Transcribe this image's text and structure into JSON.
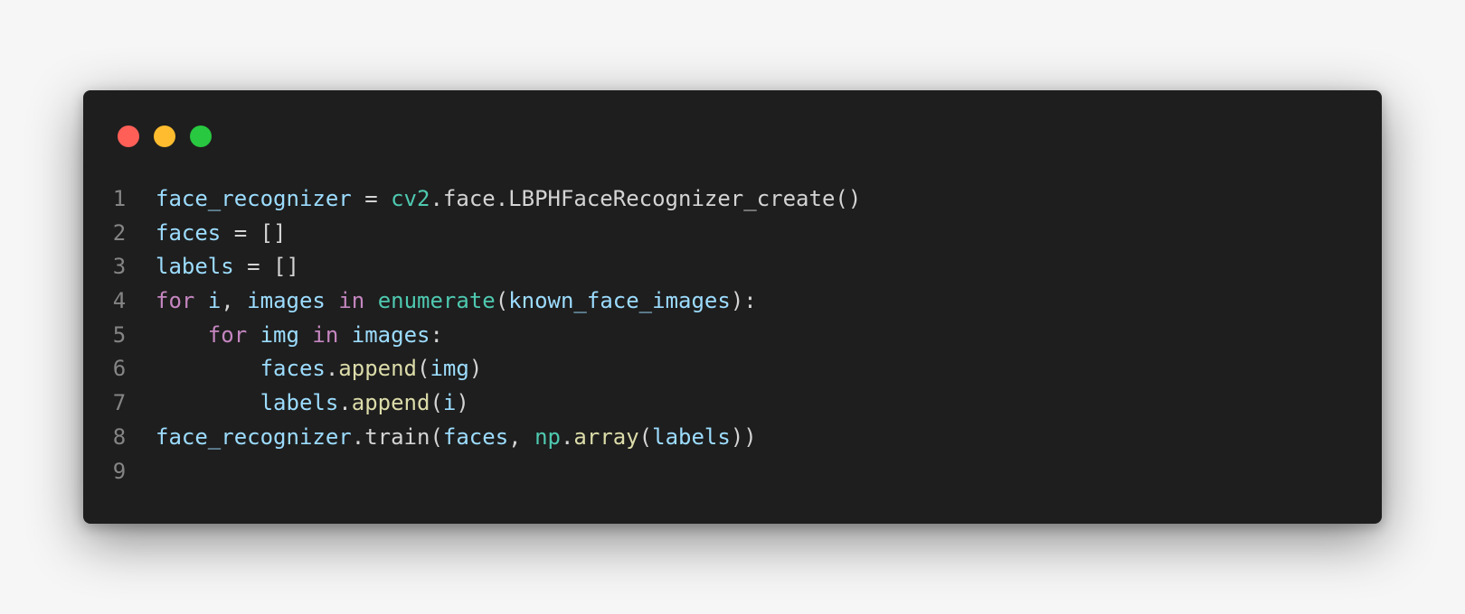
{
  "window": {
    "controls": [
      {
        "name": "close",
        "color": "#ff5f57"
      },
      {
        "name": "minimize",
        "color": "#febc2e"
      },
      {
        "name": "zoom",
        "color": "#28c840"
      }
    ]
  },
  "colors": {
    "background": "#1e1e1e",
    "variable": "#9cdcfe",
    "keyword": "#c586c0",
    "module": "#4ec9b0",
    "function": "#dcdcaa",
    "plain": "#d4d4d4",
    "line_number": "#858585"
  },
  "code": {
    "lines": [
      {
        "number": "1",
        "indent": "",
        "tokens": [
          {
            "text": "face_recognizer",
            "type": "variable"
          },
          {
            "text": " = ",
            "type": "plain"
          },
          {
            "text": "cv2",
            "type": "module"
          },
          {
            "text": ".face.LBPHFaceRecognizer_create()",
            "type": "plain"
          }
        ]
      },
      {
        "number": "2",
        "indent": "",
        "tokens": [
          {
            "text": "faces",
            "type": "variable"
          },
          {
            "text": " = []",
            "type": "plain"
          }
        ]
      },
      {
        "number": "3",
        "indent": "",
        "tokens": [
          {
            "text": "labels",
            "type": "variable"
          },
          {
            "text": " = []",
            "type": "plain"
          }
        ]
      },
      {
        "number": "4",
        "indent": "",
        "tokens": [
          {
            "text": "for",
            "type": "keyword"
          },
          {
            "text": " ",
            "type": "plain"
          },
          {
            "text": "i",
            "type": "variable"
          },
          {
            "text": ", ",
            "type": "plain"
          },
          {
            "text": "images",
            "type": "variable"
          },
          {
            "text": " ",
            "type": "plain"
          },
          {
            "text": "in",
            "type": "keyword"
          },
          {
            "text": " ",
            "type": "plain"
          },
          {
            "text": "enumerate",
            "type": "module"
          },
          {
            "text": "(",
            "type": "plain"
          },
          {
            "text": "known_face_images",
            "type": "variable"
          },
          {
            "text": "):",
            "type": "plain"
          }
        ]
      },
      {
        "number": "5",
        "indent": "    ",
        "tokens": [
          {
            "text": "for",
            "type": "keyword"
          },
          {
            "text": " ",
            "type": "plain"
          },
          {
            "text": "img",
            "type": "variable"
          },
          {
            "text": " ",
            "type": "plain"
          },
          {
            "text": "in",
            "type": "keyword"
          },
          {
            "text": " ",
            "type": "plain"
          },
          {
            "text": "images",
            "type": "variable"
          },
          {
            "text": ":",
            "type": "plain"
          }
        ]
      },
      {
        "number": "6",
        "indent": "        ",
        "tokens": [
          {
            "text": "faces",
            "type": "variable"
          },
          {
            "text": ".",
            "type": "plain"
          },
          {
            "text": "append",
            "type": "function"
          },
          {
            "text": "(",
            "type": "plain"
          },
          {
            "text": "img",
            "type": "variable"
          },
          {
            "text": ")",
            "type": "plain"
          }
        ]
      },
      {
        "number": "7",
        "indent": "        ",
        "tokens": [
          {
            "text": "labels",
            "type": "variable"
          },
          {
            "text": ".",
            "type": "plain"
          },
          {
            "text": "append",
            "type": "function"
          },
          {
            "text": "(",
            "type": "plain"
          },
          {
            "text": "i",
            "type": "variable"
          },
          {
            "text": ")",
            "type": "plain"
          }
        ]
      },
      {
        "number": "8",
        "indent": "",
        "tokens": [
          {
            "text": "face_recognizer",
            "type": "variable"
          },
          {
            "text": ".train(",
            "type": "plain"
          },
          {
            "text": "faces",
            "type": "variable"
          },
          {
            "text": ", ",
            "type": "plain"
          },
          {
            "text": "np",
            "type": "module"
          },
          {
            "text": ".",
            "type": "plain"
          },
          {
            "text": "array",
            "type": "function"
          },
          {
            "text": "(",
            "type": "plain"
          },
          {
            "text": "labels",
            "type": "variable"
          },
          {
            "text": "))",
            "type": "plain"
          }
        ]
      },
      {
        "number": "9",
        "indent": "",
        "tokens": []
      }
    ]
  }
}
